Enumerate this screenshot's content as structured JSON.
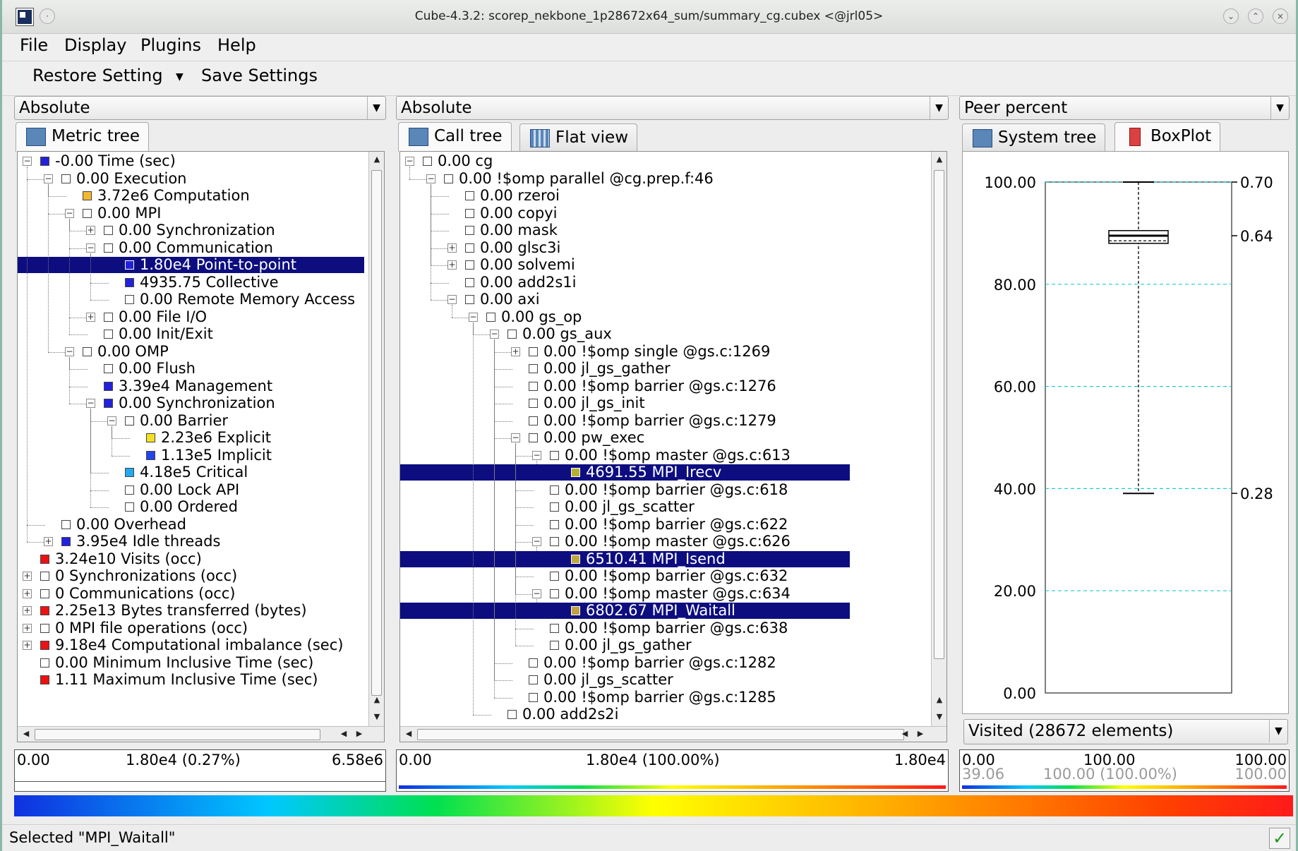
{
  "window": {
    "title": "Cube-4.3.2: scorep_nekbone_1p28672x64_sum/summary_cg.cubex <@jrl05>"
  },
  "menu": [
    "File",
    "Display",
    "Plugins",
    "Help"
  ],
  "toolbar": {
    "restore": "Restore Setting",
    "save": "Save Settings"
  },
  "panes": {
    "left": {
      "mode": "Absolute",
      "tabs": [
        "Metric tree"
      ]
    },
    "mid": {
      "mode": "Absolute",
      "tabs": [
        "Call tree",
        "Flat view"
      ]
    },
    "right": {
      "mode": "Peer percent",
      "tabs": [
        "System tree",
        "BoxPlot"
      ]
    }
  },
  "metric_tree": [
    {
      "d": 0,
      "exp": "-",
      "color": "#2222dd",
      "text": "-0.00 Time (sec)"
    },
    {
      "d": 1,
      "exp": "-",
      "color": "#ffffff",
      "text": "0.00 Execution"
    },
    {
      "d": 2,
      "exp": "",
      "color": "#f2b830",
      "text": "3.72e6 Computation"
    },
    {
      "d": 2,
      "exp": "-",
      "color": "#ffffff",
      "text": "0.00 MPI"
    },
    {
      "d": 3,
      "exp": "+",
      "color": "#ffffff",
      "text": "0.00 Synchronization"
    },
    {
      "d": 3,
      "exp": "-",
      "color": "#ffffff",
      "text": "0.00 Communication"
    },
    {
      "d": 4,
      "exp": "",
      "color": "#2222dd",
      "text": "1.80e4 Point-to-point",
      "sel": true
    },
    {
      "d": 4,
      "exp": "",
      "color": "#2222dd",
      "text": "4935.75 Collective"
    },
    {
      "d": 4,
      "exp": "",
      "color": "#ffffff",
      "text": "0.00 Remote Memory Access"
    },
    {
      "d": 3,
      "exp": "+",
      "color": "#ffffff",
      "text": "0.00 File I/O"
    },
    {
      "d": 3,
      "exp": "",
      "color": "#ffffff",
      "text": "0.00 Init/Exit"
    },
    {
      "d": 2,
      "exp": "-",
      "color": "#ffffff",
      "text": "0.00 OMP"
    },
    {
      "d": 3,
      "exp": "",
      "color": "#ffffff",
      "text": "0.00 Flush"
    },
    {
      "d": 3,
      "exp": "",
      "color": "#2222dd",
      "text": "3.39e4 Management"
    },
    {
      "d": 3,
      "exp": "-",
      "color": "#2222dd",
      "text": "0.00 Synchronization"
    },
    {
      "d": 4,
      "exp": "-",
      "color": "#ffffff",
      "text": "0.00 Barrier"
    },
    {
      "d": 5,
      "exp": "",
      "color": "#f2e020",
      "text": "2.23e6 Explicit"
    },
    {
      "d": 5,
      "exp": "",
      "color": "#2244ee",
      "text": "1.13e5 Implicit"
    },
    {
      "d": 4,
      "exp": "",
      "color": "#22aaee",
      "text": "4.18e5 Critical"
    },
    {
      "d": 4,
      "exp": "",
      "color": "#ffffff",
      "text": "0.00 Lock API"
    },
    {
      "d": 4,
      "exp": "",
      "color": "#ffffff",
      "text": "0.00 Ordered"
    },
    {
      "d": 1,
      "exp": "",
      "color": "#ffffff",
      "text": "0.00 Overhead"
    },
    {
      "d": 1,
      "exp": "+",
      "color": "#2222dd",
      "text": "3.95e4 Idle threads"
    },
    {
      "d": 0,
      "exp": "",
      "color": "#ee1111",
      "text": "3.24e10 Visits (occ)"
    },
    {
      "d": 0,
      "exp": "+",
      "color": "#ffffff",
      "text": "0 Synchronizations (occ)"
    },
    {
      "d": 0,
      "exp": "+",
      "color": "#ffffff",
      "text": "0 Communications (occ)"
    },
    {
      "d": 0,
      "exp": "+",
      "color": "#ee1111",
      "text": "2.25e13 Bytes transferred (bytes)"
    },
    {
      "d": 0,
      "exp": "+",
      "color": "#ffffff",
      "text": "0 MPI file operations (occ)"
    },
    {
      "d": 0,
      "exp": "+",
      "color": "#ee1111",
      "text": "9.18e4 Computational imbalance (sec)"
    },
    {
      "d": 0,
      "exp": "",
      "color": "#ffffff",
      "text": "0.00 Minimum Inclusive Time (sec)"
    },
    {
      "d": 0,
      "exp": "",
      "color": "#ee1111",
      "text": "1.11 Maximum Inclusive Time (sec)"
    }
  ],
  "call_tree": [
    {
      "d": 0,
      "exp": "-",
      "color": "#ffffff",
      "text": "0.00 cg"
    },
    {
      "d": 1,
      "exp": "-",
      "color": "#ffffff",
      "text": "0.00 !$omp parallel @cg.prep.f:46"
    },
    {
      "d": 2,
      "exp": "",
      "color": "#ffffff",
      "text": "0.00 rzeroi"
    },
    {
      "d": 2,
      "exp": "",
      "color": "#ffffff",
      "text": "0.00 copyi"
    },
    {
      "d": 2,
      "exp": "",
      "color": "#ffffff",
      "text": "0.00 mask"
    },
    {
      "d": 2,
      "exp": "+",
      "color": "#ffffff",
      "text": "0.00 glsc3i"
    },
    {
      "d": 2,
      "exp": "+",
      "color": "#ffffff",
      "text": "0.00 solvemi"
    },
    {
      "d": 2,
      "exp": "",
      "color": "#ffffff",
      "text": "0.00 add2s1i"
    },
    {
      "d": 2,
      "exp": "-",
      "color": "#ffffff",
      "text": "0.00 axi"
    },
    {
      "d": 3,
      "exp": "-",
      "color": "#ffffff",
      "text": "0.00 gs_op"
    },
    {
      "d": 4,
      "exp": "-",
      "color": "#ffffff",
      "text": "0.00 gs_aux"
    },
    {
      "d": 5,
      "exp": "+",
      "color": "#ffffff",
      "text": "0.00 !$omp single @gs.c:1269"
    },
    {
      "d": 5,
      "exp": "",
      "color": "#ffffff",
      "text": "0.00 jl_gs_gather"
    },
    {
      "d": 5,
      "exp": "",
      "color": "#ffffff",
      "text": "0.00 !$omp barrier @gs.c:1276"
    },
    {
      "d": 5,
      "exp": "",
      "color": "#ffffff",
      "text": "0.00 jl_gs_init"
    },
    {
      "d": 5,
      "exp": "",
      "color": "#ffffff",
      "text": "0.00 !$omp barrier @gs.c:1279"
    },
    {
      "d": 5,
      "exp": "-",
      "color": "#ffffff",
      "text": "0.00 pw_exec"
    },
    {
      "d": 6,
      "exp": "-",
      "color": "#ffffff",
      "text": "0.00 !$omp master @gs.c:613"
    },
    {
      "d": 7,
      "exp": "",
      "color": "#b8b030",
      "text": "4691.55 MPI_Irecv",
      "sel": true
    },
    {
      "d": 6,
      "exp": "",
      "color": "#ffffff",
      "text": "0.00 !$omp barrier @gs.c:618"
    },
    {
      "d": 6,
      "exp": "",
      "color": "#ffffff",
      "text": "0.00 jl_gs_scatter"
    },
    {
      "d": 6,
      "exp": "",
      "color": "#ffffff",
      "text": "0.00 !$omp barrier @gs.c:622"
    },
    {
      "d": 6,
      "exp": "-",
      "color": "#ffffff",
      "text": "0.00 !$omp master @gs.c:626"
    },
    {
      "d": 7,
      "exp": "",
      "color": "#c0a840",
      "text": "6510.41 MPI_Isend",
      "sel": true
    },
    {
      "d": 6,
      "exp": "",
      "color": "#ffffff",
      "text": "0.00 !$omp barrier @gs.c:632"
    },
    {
      "d": 6,
      "exp": "-",
      "color": "#ffffff",
      "text": "0.00 !$omp master @gs.c:634"
    },
    {
      "d": 7,
      "exp": "",
      "color": "#c0a040",
      "text": "6802.67 MPI_Waitall",
      "sel": true
    },
    {
      "d": 6,
      "exp": "",
      "color": "#ffffff",
      "text": "0.00 !$omp barrier @gs.c:638"
    },
    {
      "d": 6,
      "exp": "",
      "color": "#ffffff",
      "text": "0.00 jl_gs_gather"
    },
    {
      "d": 5,
      "exp": "",
      "color": "#ffffff",
      "text": "0.00 !$omp barrier @gs.c:1282"
    },
    {
      "d": 5,
      "exp": "",
      "color": "#ffffff",
      "text": "0.00 jl_gs_scatter"
    },
    {
      "d": 5,
      "exp": "",
      "color": "#ffffff",
      "text": "0.00 !$omp barrier @gs.c:1285"
    },
    {
      "d": 4,
      "exp": "",
      "color": "#ffffff",
      "text": "0.00 add2s2i"
    }
  ],
  "boxplot": {
    "y_ticks": [
      "100.00",
      "80.00",
      "60.00",
      "40.00",
      "20.00",
      "0.00"
    ],
    "right_labels": [
      "0.70",
      "0.64",
      "0.28"
    ],
    "visited": "Visited (28672 elements)"
  },
  "chart_data": {
    "type": "boxplot",
    "ylim": [
      0,
      100
    ],
    "grid": true,
    "whisker_max": 100.0,
    "q3": 90.5,
    "median": 89.5,
    "mean": 88.5,
    "q1": 88.0,
    "whisker_min": 39.06,
    "right_labels": [
      {
        "value": 100.0,
        "label": "0.70"
      },
      {
        "value": 89.5,
        "label": "0.64"
      },
      {
        "value": 39.06,
        "label": "0.28"
      }
    ]
  },
  "values": {
    "left": {
      "min": "0.00",
      "center": "1.80e4 (0.27%)",
      "max": "6.58e6"
    },
    "mid": {
      "min": "0.00",
      "center": "1.80e4 (100.00%)",
      "max": "1.80e4"
    },
    "right": {
      "min": "0.00",
      "center": "100.00",
      "max": "100.00",
      "min2": "39.06",
      "center2": "100.00 (100.00%)",
      "max2": "100.00"
    }
  },
  "status": {
    "message": "Selected \"MPI_Waitall\"",
    "ok_icon": "✓"
  }
}
